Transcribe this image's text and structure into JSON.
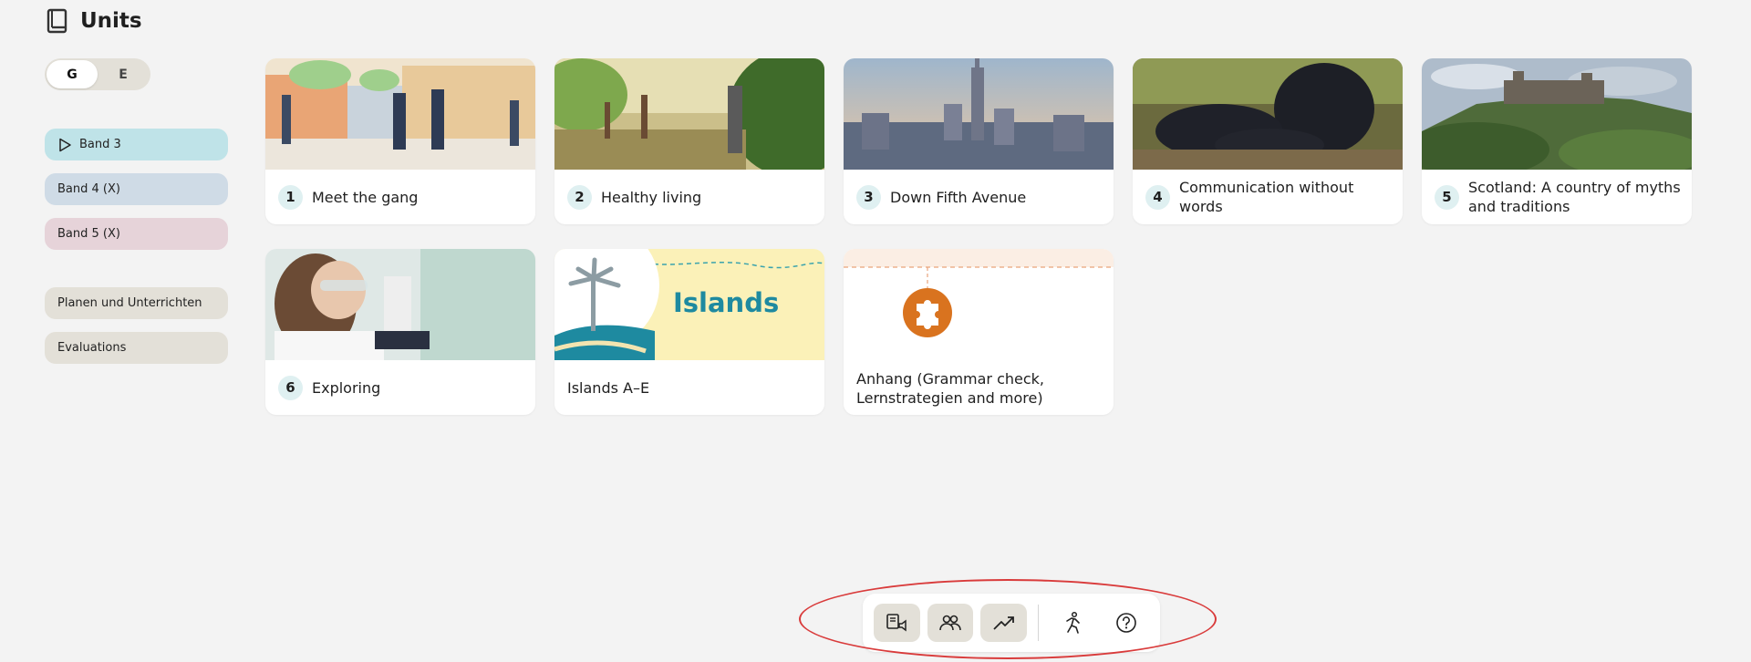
{
  "header": {
    "title": "Units",
    "icon": "book-icon"
  },
  "level_toggle": {
    "options": [
      "G",
      "E"
    ],
    "selected": "G"
  },
  "sidebar": {
    "bands": [
      {
        "label": "Band 3",
        "color": "#bfe3e8",
        "active": true
      },
      {
        "label": "Band 4 (X)",
        "color": "#cfdbe6"
      },
      {
        "label": "Band 5 (X)",
        "color": "#e6d3d9"
      }
    ],
    "links": [
      {
        "label": "Planen und Unterrichten"
      },
      {
        "label": "Evaluations"
      }
    ]
  },
  "units": [
    {
      "number": "1",
      "title": "Meet the gang"
    },
    {
      "number": "2",
      "title": "Healthy living"
    },
    {
      "number": "3",
      "title": "Down Fifth Avenue"
    },
    {
      "number": "4",
      "title": "Communication without words"
    },
    {
      "number": "5",
      "title": "Scotland: A country of myths and traditions"
    },
    {
      "number": "6",
      "title": "Exploring"
    },
    {
      "number": "",
      "title": "Islands A–E",
      "banner_text": "Islands"
    },
    {
      "number": "",
      "title": "Anhang (Grammar check, Lernstrategien and more)"
    }
  ],
  "toolbar": {
    "items": [
      {
        "icon": "read-aloud-icon"
      },
      {
        "icon": "group-icon"
      },
      {
        "icon": "progress-chart-icon"
      },
      {
        "icon": "running-person-icon"
      },
      {
        "icon": "help-icon"
      }
    ]
  },
  "colors": {
    "accent_teal": "#1e8aa0",
    "puzzle_orange": "#d9731f",
    "highlight_red": "#d93b3b"
  }
}
